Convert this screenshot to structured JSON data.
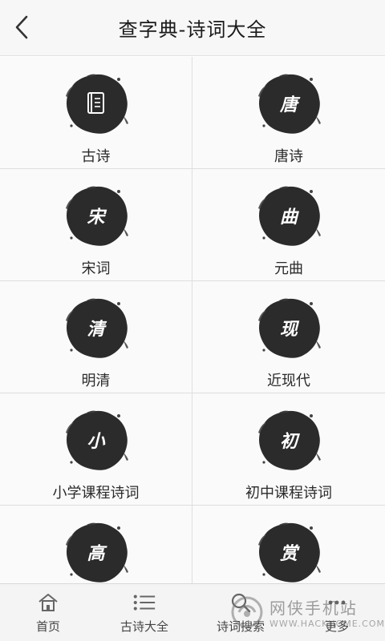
{
  "header": {
    "title": "查字典-诗词大全",
    "back_icon": "chevron-left-icon"
  },
  "categories": [
    {
      "label": "古诗",
      "glyph": "",
      "icon": "book-icon"
    },
    {
      "label": "唐诗",
      "glyph": "唐"
    },
    {
      "label": "宋词",
      "glyph": "宋"
    },
    {
      "label": "元曲",
      "glyph": "曲"
    },
    {
      "label": "明清",
      "glyph": "清"
    },
    {
      "label": "近现代",
      "glyph": "现"
    },
    {
      "label": "小学课程诗词",
      "glyph": "小"
    },
    {
      "label": "初中课程诗词",
      "glyph": "初"
    },
    {
      "label": "",
      "glyph": "高"
    },
    {
      "label": "",
      "glyph": "赏"
    }
  ],
  "tabbar": {
    "tabs": [
      {
        "label": "首页",
        "icon": "home-icon"
      },
      {
        "label": "古诗大全",
        "icon": "list-icon"
      },
      {
        "label": "诗词搜索",
        "icon": "search-icon"
      },
      {
        "label": "更多",
        "icon": "more-icon"
      }
    ]
  },
  "watermark": {
    "top": "网侠手机站",
    "bottom": "WWW.HACKHOME.COM"
  },
  "colors": {
    "ink": "#2b2b2b",
    "header_bg": "#f7f7f7",
    "tabbar_bg": "#f4f4f4"
  }
}
